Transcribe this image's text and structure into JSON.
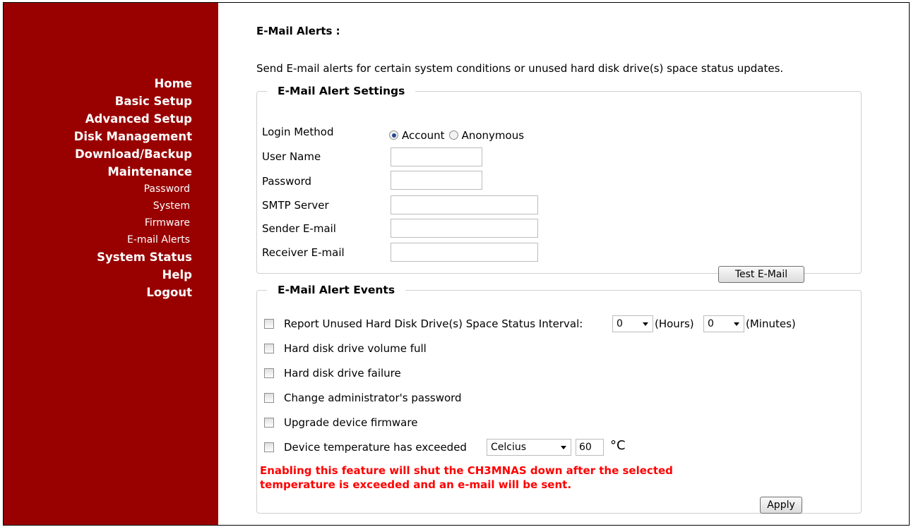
{
  "sidebar": {
    "items": [
      {
        "label": "Home"
      },
      {
        "label": "Basic Setup"
      },
      {
        "label": "Advanced Setup"
      },
      {
        "label": "Disk Management"
      },
      {
        "label": "Download/Backup"
      },
      {
        "label": "Maintenance"
      }
    ],
    "sub_items": [
      {
        "label": "Password"
      },
      {
        "label": "System"
      },
      {
        "label": "Firmware"
      },
      {
        "label": "E-mail Alerts"
      }
    ],
    "bottom_items": [
      {
        "label": "System Status"
      },
      {
        "label": "Help"
      },
      {
        "label": "Logout"
      }
    ],
    "background_color": "#990000"
  },
  "page": {
    "title": "E-Mail Alerts :",
    "description": "Send E-mail alerts for certain system conditions or unused hard disk drive(s) space status updates."
  },
  "settings": {
    "legend": "E-Mail Alert Settings",
    "login_method_label": "Login Method",
    "login_options": [
      "Account",
      "Anonymous"
    ],
    "login_selected": "Account",
    "user_name_label": "User Name",
    "user_name_value": "",
    "password_label": "Password",
    "password_value": "",
    "smtp_label": "SMTP Server",
    "smtp_value": "",
    "sender_label": "Sender E-mail",
    "sender_value": "",
    "receiver_label": "Receiver E-mail",
    "receiver_value": "",
    "test_button": "Test E-Mail"
  },
  "events": {
    "legend": "E-Mail Alert Events",
    "report_label": "Report Unused Hard Disk Drive(s) Space Status Interval:",
    "hours_value": "0",
    "hours_unit": "(Hours)",
    "minutes_value": "0",
    "minutes_unit": "(Minutes)",
    "volume_full_label": "Hard disk drive volume full",
    "failure_label": "Hard disk drive failure",
    "admin_password_label": "Change administrator's password",
    "firmware_label": "Upgrade device firmware",
    "temperature_label": "Device temperature has exceeded",
    "temperature_unit_select": "Celcius",
    "temperature_value": "60",
    "temperature_symbol": "°C",
    "warning": "Enabling this feature will shut the CH3MNAS down after the selected temperature is exceeded and an e-mail will be sent.",
    "warning_color": "#ff0000",
    "apply_button": "Apply"
  }
}
